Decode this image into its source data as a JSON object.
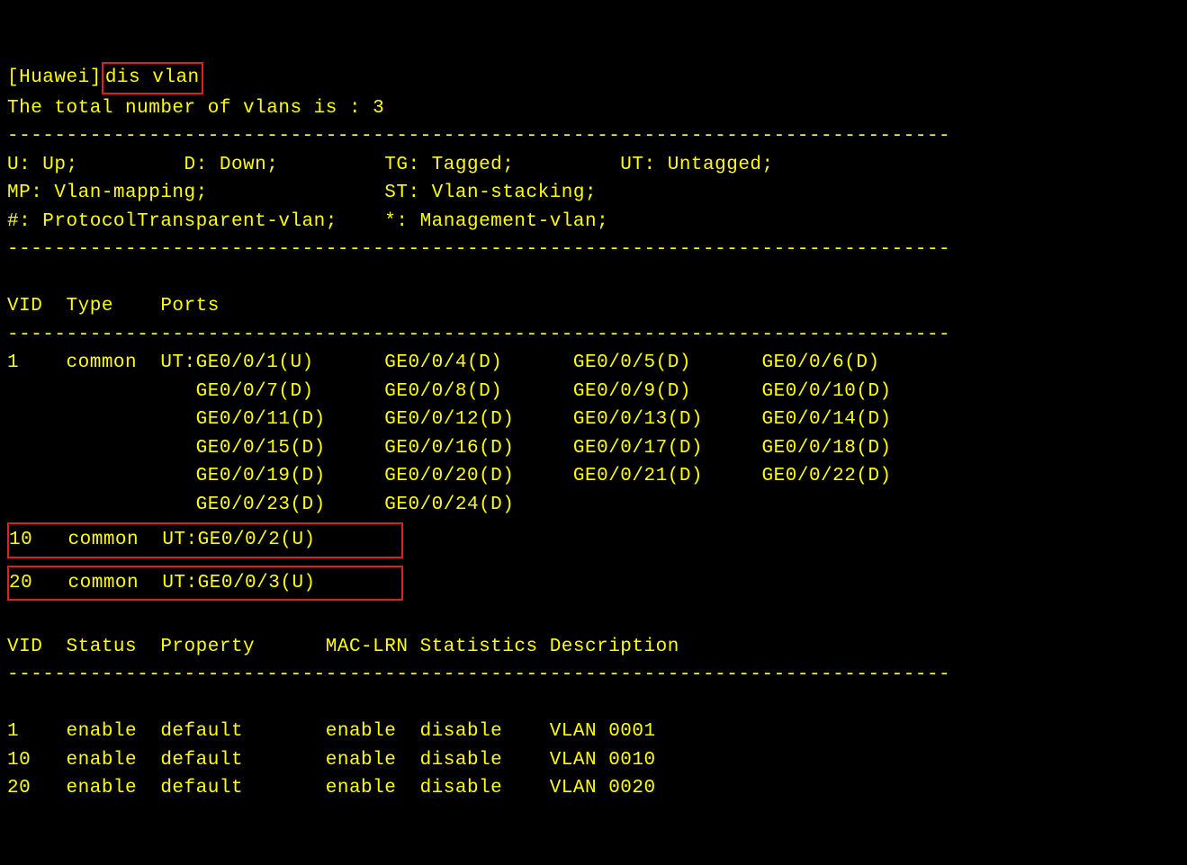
{
  "prompt": {
    "host": "[Huawei]",
    "command": "dis vlan"
  },
  "summary": "The total number of vlans is : 3",
  "legend": {
    "line1": "U: Up;         D: Down;         TG: Tagged;         UT: Untagged;",
    "line2": "MP: Vlan-mapping;               ST: Vlan-stacking;",
    "line3": "#: ProtocolTransparent-vlan;    *: Management-vlan;"
  },
  "dash": "--------------------------------------------------------------------------------",
  "ports_table": {
    "header": "VID  Type    Ports",
    "vlan1": {
      "l1": "1    common  UT:GE0/0/1(U)      GE0/0/4(D)      GE0/0/5(D)      GE0/0/6(D)",
      "l2": "                GE0/0/7(D)      GE0/0/8(D)      GE0/0/9(D)      GE0/0/10(D)",
      "l3": "                GE0/0/11(D)     GE0/0/12(D)     GE0/0/13(D)     GE0/0/14(D)",
      "l4": "                GE0/0/15(D)     GE0/0/16(D)     GE0/0/17(D)     GE0/0/18(D)",
      "l5": "                GE0/0/19(D)     GE0/0/20(D)     GE0/0/21(D)     GE0/0/22(D)",
      "l6": "                GE0/0/23(D)     GE0/0/24(D)"
    },
    "vlan10": "10   common  UT:GE0/0/2(U)       ",
    "vlan20": "20   common  UT:GE0/0/3(U)       "
  },
  "status_table": {
    "header": "VID  Status  Property      MAC-LRN Statistics Description",
    "r1": "1    enable  default       enable  disable    VLAN 0001",
    "r2": "10   enable  default       enable  disable    VLAN 0010",
    "r3": "20   enable  default       enable  disable    VLAN 0020"
  }
}
